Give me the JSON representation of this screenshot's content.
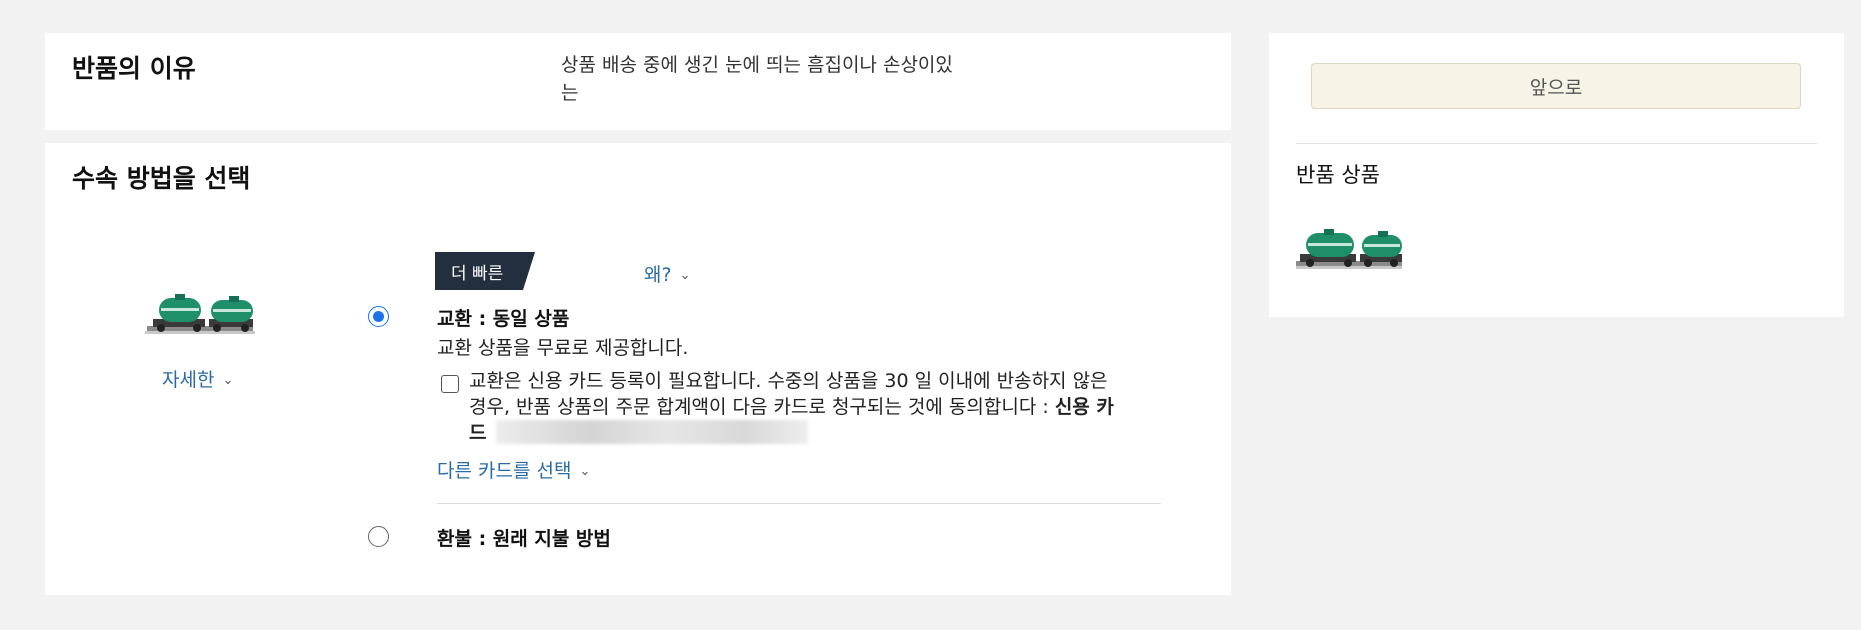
{
  "reason_section": {
    "title": "반품의 이유",
    "reason_line1": "상품 배송 중에 생긴 눈에 띄는 흠집이나 손상이있",
    "reason_line2": "는"
  },
  "method_section": {
    "title": "수속 방법을 선택",
    "details_link": "자세한",
    "badge": "더 빠른",
    "why_link": "왜?",
    "options": [
      {
        "title": "교환 : 동일 상품",
        "selected": true,
        "description": "교환 상품을 무료로 제공합니다.",
        "agree_line1": "교환은 신용 카드 등록이 필요합니다. 수중의 상품을 30 일 이내에 반송하지 않은",
        "agree_line2": "경우, 반품 상품의 주문 합계액이 다음 카드로 청구되는 것에 동의합니다 : ",
        "agree_bold1": "신용 카",
        "agree_bold2": "드",
        "other_card_link": "다른 카드를 선택"
      },
      {
        "title": "환불 : 원래 지불 방법",
        "selected": false
      }
    ]
  },
  "sidebar": {
    "next_button": "앞으로",
    "returned_items_label": "반품 상품"
  },
  "colors": {
    "link": "#2a6aa6",
    "badge_bg": "#232f3e",
    "radio_selected": "#1a73e8",
    "next_button_bg": "#f7f3e6",
    "page_bg": "#f2f2f2"
  },
  "icons": {
    "chevron": "chevron-down-icon",
    "product": "tank-train-toy-image"
  }
}
